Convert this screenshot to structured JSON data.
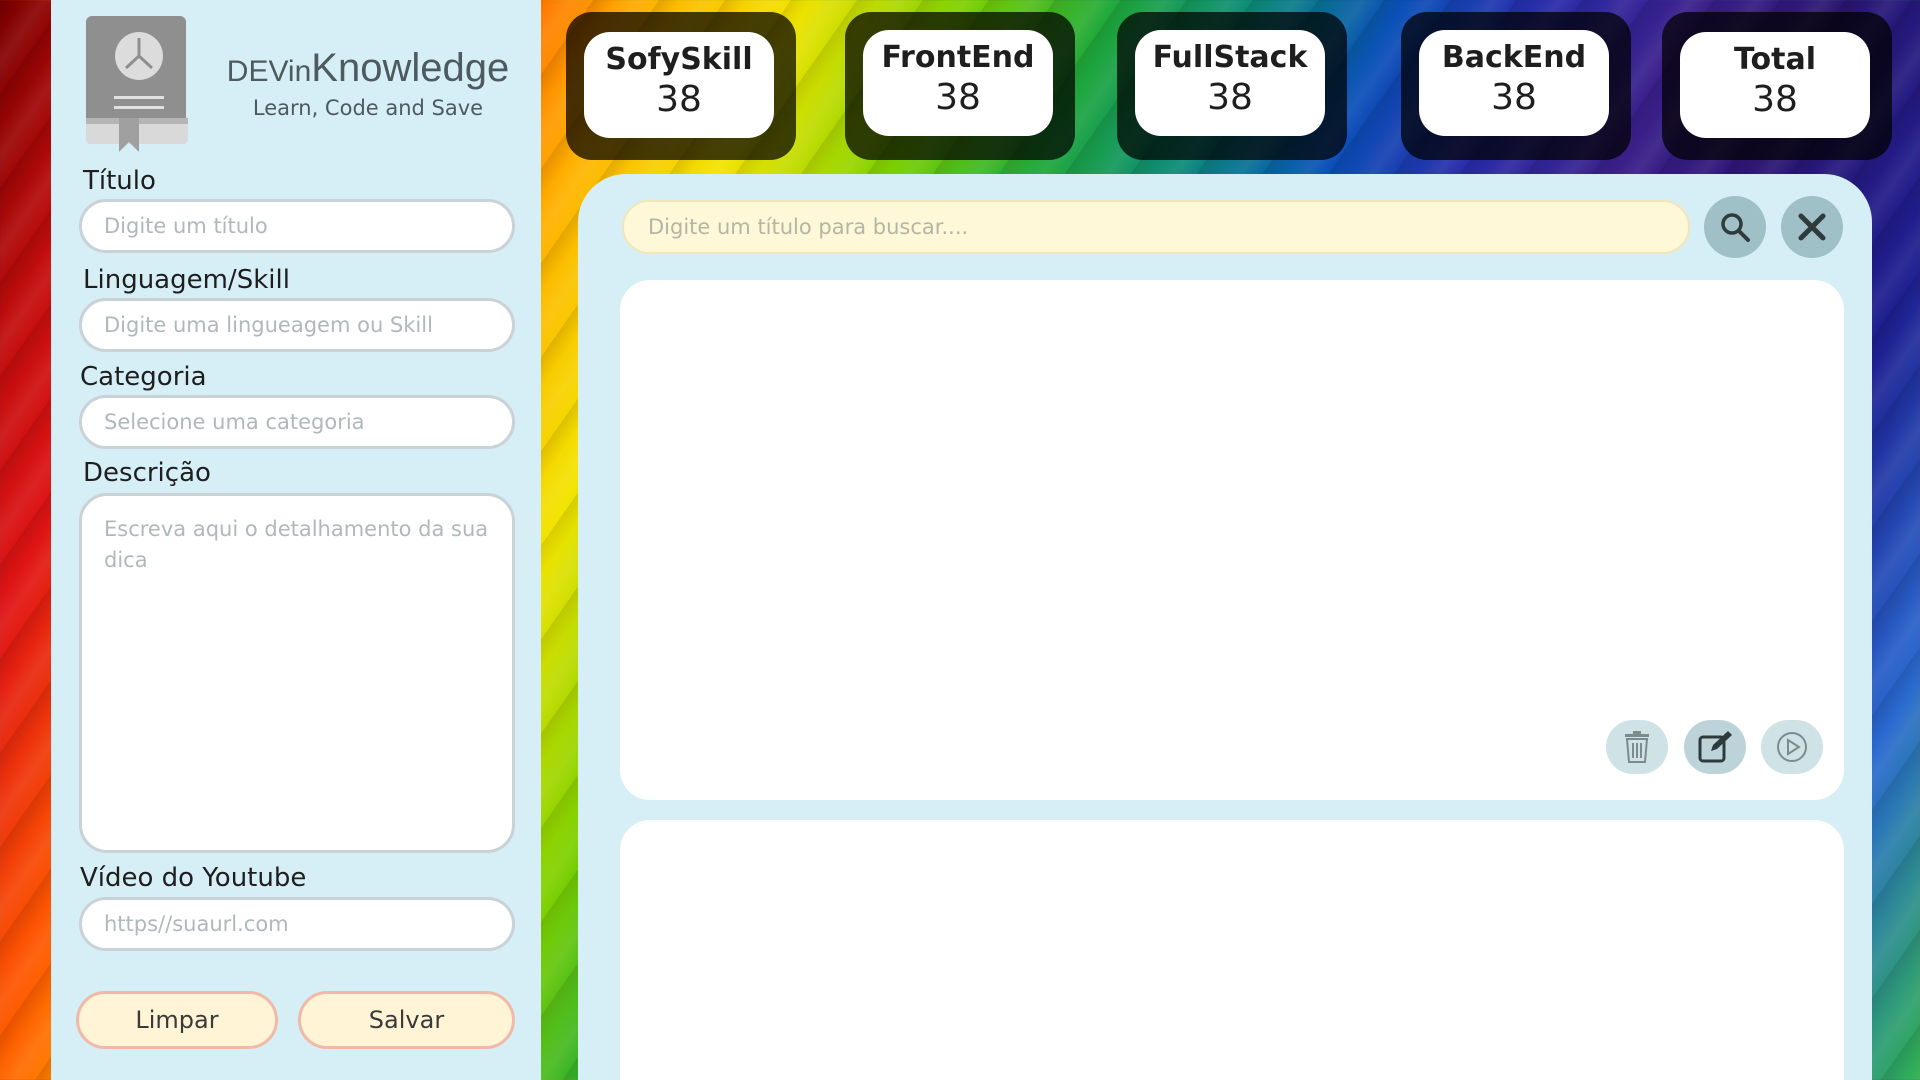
{
  "brand": {
    "prefix": "DEVin",
    "name": "Knowledge",
    "tagline": "Learn, Code and Save",
    "logo_icon": "book-icon"
  },
  "form": {
    "titulo_label": "Título",
    "titulo_placeholder": "Digite um título",
    "linguagem_label": "Linguagem/Skill",
    "linguagem_placeholder": "Digite uma lingueagem ou Skill",
    "categoria_label": "Categoria",
    "categoria_placeholder": "Selecione uma categoria",
    "descricao_label": "Descrição",
    "descricao_placeholder": "Escreva aqui o detalhamento da sua dica",
    "video_label": "Vídeo do Youtube",
    "video_placeholder": "https//suaurl.com",
    "limpar_label": "Limpar",
    "salvar_label": "Salvar"
  },
  "stats": [
    {
      "title": "SofySkill",
      "value": "38"
    },
    {
      "title": "FrontEnd",
      "value": "38"
    },
    {
      "title": "FullStack",
      "value": "38"
    },
    {
      "title": "BackEnd",
      "value": "38"
    },
    {
      "title": "Total",
      "value": "38"
    }
  ],
  "search": {
    "placeholder": "Digite um título para buscar....",
    "search_icon": "search-icon",
    "clear_icon": "close-icon"
  },
  "card_actions": [
    "trash-icon",
    "edit-icon",
    "play-icon"
  ],
  "colors": {
    "panel": "#d6eef5",
    "search_bg": "#fff8d8",
    "button_bg": "#fff5d6",
    "button_border": "#f2b8a8",
    "round_button": "#9ec0c6"
  }
}
